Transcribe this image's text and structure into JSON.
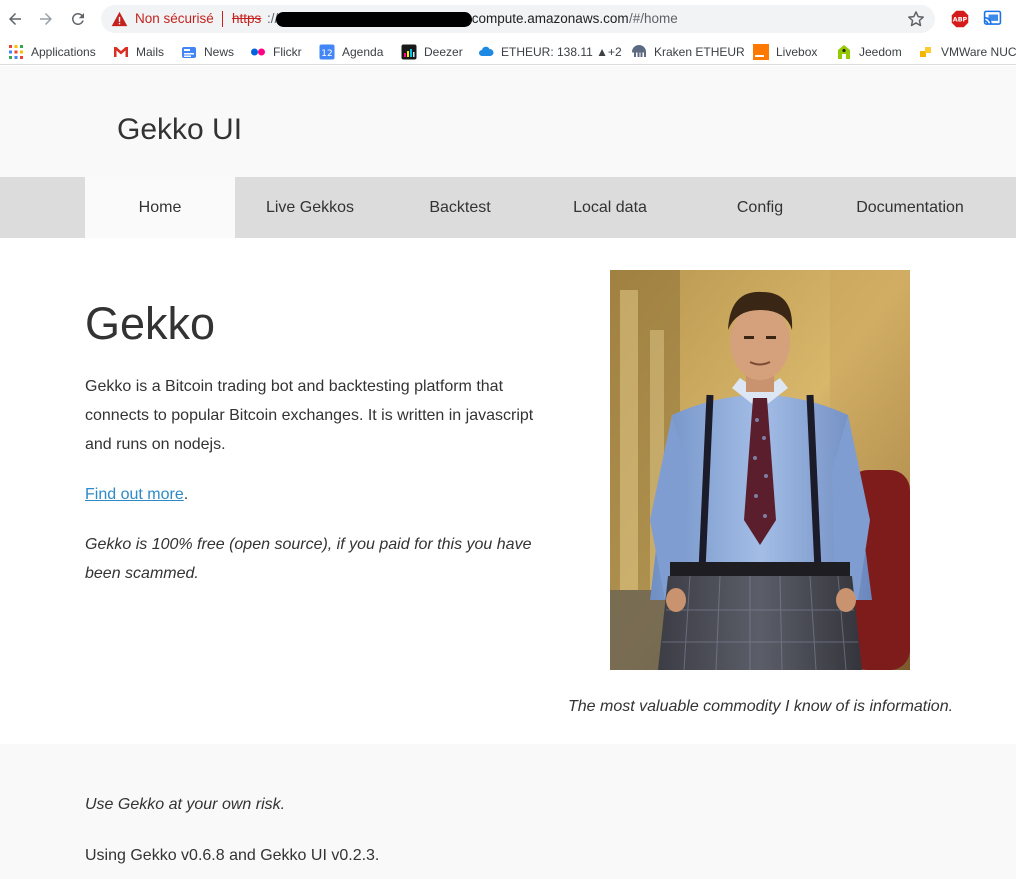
{
  "browser": {
    "security_label": "Non sécurisé",
    "url_scheme": "https",
    "url_slashes": "://",
    "url_host_suffix": ".compute.amazonaws.com",
    "url_path": "/#/home"
  },
  "bookmarks": [
    {
      "label": "Applications",
      "icon": "apps-grid-icon"
    },
    {
      "label": "Mails",
      "icon": "gmail-icon"
    },
    {
      "label": "News",
      "icon": "news-icon"
    },
    {
      "label": "Flickr",
      "icon": "flickr-icon"
    },
    {
      "label": "Agenda",
      "icon": "calendar-icon",
      "badge": "12"
    },
    {
      "label": "Deezer",
      "icon": "deezer-icon"
    },
    {
      "label": "ETHEUR: 138.11 ▲+2",
      "icon": "cloud-icon"
    },
    {
      "label": "Kraken ETHEUR",
      "icon": "kraken-icon"
    },
    {
      "label": "Livebox",
      "icon": "orange-icon"
    },
    {
      "label": "Jeedom",
      "icon": "jeedom-icon"
    },
    {
      "label": "VMWare NUC",
      "icon": "vmware-icon"
    }
  ],
  "site": {
    "title": "Gekko UI"
  },
  "menu": [
    {
      "label": "Home",
      "active": true
    },
    {
      "label": "Live Gekkos",
      "active": false
    },
    {
      "label": "Backtest",
      "active": false
    },
    {
      "label": "Local data",
      "active": false
    },
    {
      "label": "Config",
      "active": false
    },
    {
      "label": "Documentation",
      "active": false
    }
  ],
  "main": {
    "heading": "Gekko",
    "intro": "Gekko is a Bitcoin trading bot and backtesting platform that connects to popular Bitcoin exchanges. It is written in javascript and runs on nodejs.",
    "find_out_more": "Find out more",
    "find_out_more_suffix": ".",
    "free_note": "Gekko is 100% free (open source), if you paid for this you have been scammed.",
    "quote": "The most valuable commodity I know of is information."
  },
  "footer": {
    "risk": "Use Gekko at your own risk.",
    "versions": "Using Gekko v0.6.8 and Gekko UI v0.2.3."
  },
  "colors": {
    "insecure": "#c5221f",
    "link": "#2e8ac7",
    "menu_bg": "#dcdcdc",
    "header_bg": "#f9f9f9"
  }
}
